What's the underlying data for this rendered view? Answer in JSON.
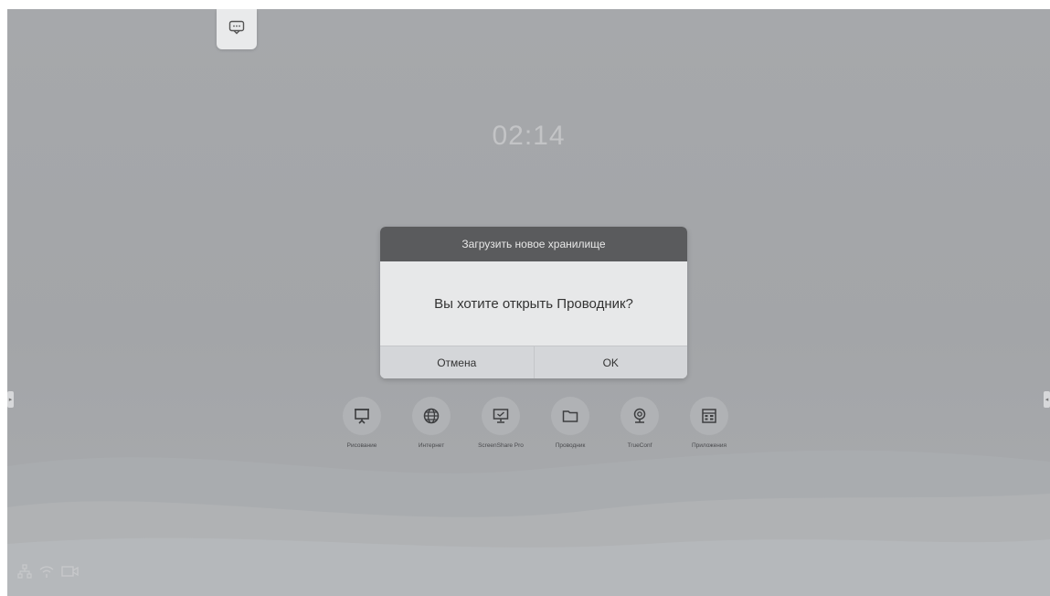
{
  "clock": {
    "time": "02:14"
  },
  "top_overlay": {
    "icon": "chat-bubble-icon"
  },
  "dialog": {
    "title": "Загрузить новое хранилище",
    "message": "Вы хотите открыть Проводник?",
    "cancel_label": "Отмена",
    "ok_label": "OK"
  },
  "apps": [
    {
      "label": "Рисование",
      "icon": "easel-icon"
    },
    {
      "label": "Интернет",
      "icon": "globe-icon"
    },
    {
      "label": "ScreenShare Pro",
      "icon": "monitor-icon"
    },
    {
      "label": "Проводник",
      "icon": "folder-icon"
    },
    {
      "label": "TrueConf",
      "icon": "webcam-icon"
    },
    {
      "label": "Приложения",
      "icon": "apps-grid-icon"
    }
  ],
  "status_icons": [
    "network-icon",
    "wifi-icon",
    "camera-icon"
  ],
  "colors": {
    "background": "#a5a7aa",
    "dialog_header": "#5a5b5d",
    "dialog_body": "#e7e8e9",
    "dialog_buttons": "#d4d6d9"
  }
}
